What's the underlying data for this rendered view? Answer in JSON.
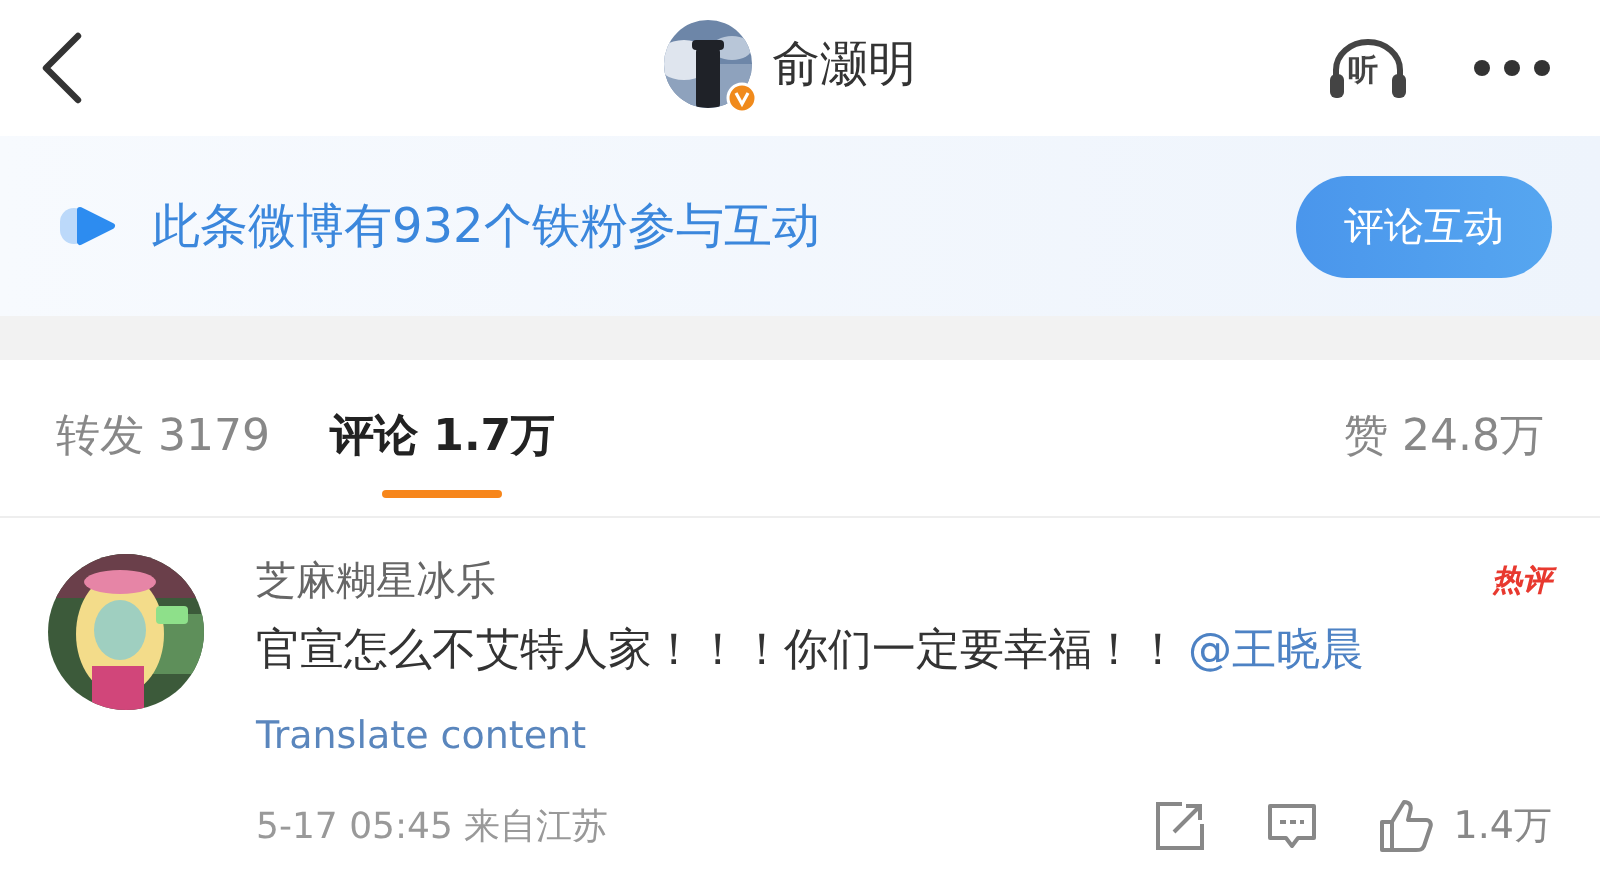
{
  "header": {
    "title": "俞灏明",
    "listen_label": "听"
  },
  "banner": {
    "text": "此条微博有932个铁粉参与互动",
    "button": "评论互动"
  },
  "tabs": [
    {
      "label": "转发 3179",
      "selected": false
    },
    {
      "label": "评论 1.7万",
      "selected": true
    },
    {
      "label": "赞 24.8万",
      "selected": false
    }
  ],
  "comment": {
    "author": "芝麻糊星冰乐",
    "badge": "热评",
    "text": "官宣怎么不艾特人家！！！你们一定要幸福！！",
    "mention": "@王晓晨",
    "translate": "Translate content",
    "meta": "5-17 05:45 来自江苏",
    "likes": "1.4万"
  }
}
